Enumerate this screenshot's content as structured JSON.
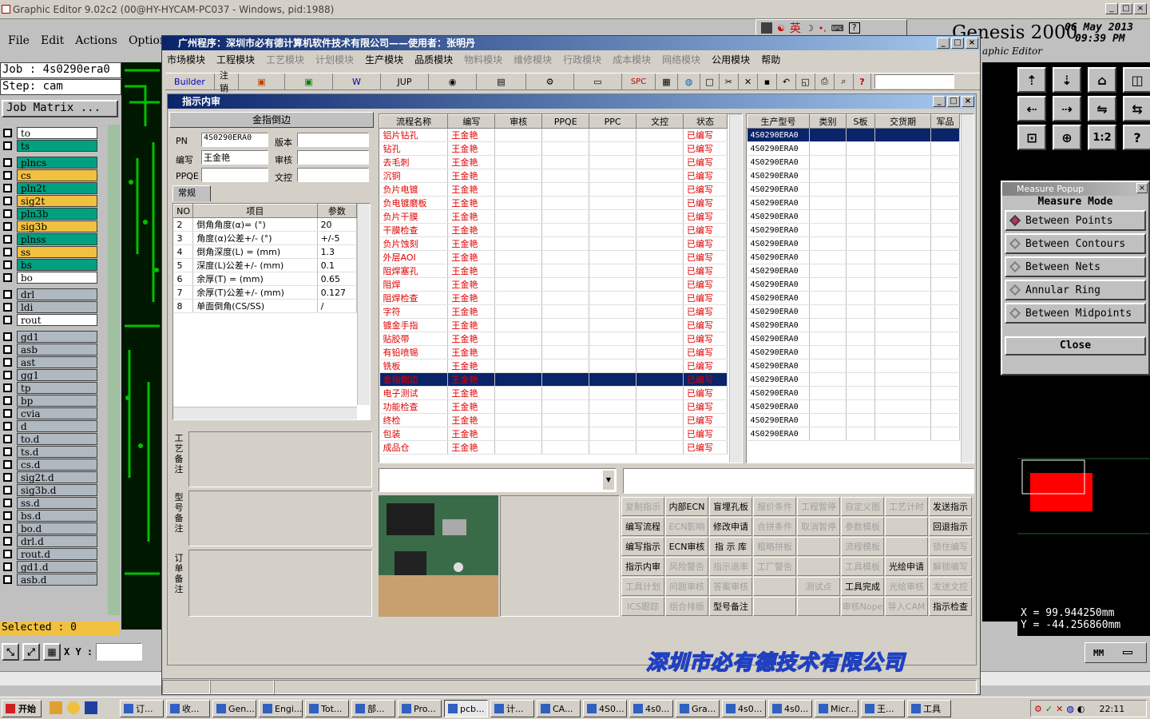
{
  "genesis": {
    "window_title": "Graphic Editor 9.02c2 (00@HY-HYCAM-PC037 - Windows, pid:1988)",
    "menu": [
      "File",
      "Edit",
      "Actions",
      "Option"
    ],
    "brand": "Genesis 2000",
    "subtitle": "aphic Editor",
    "date": "06 May 2013",
    "time": "09:39 PM",
    "job_label": "Job : 4s0290era0",
    "step_label": "Step: cam",
    "job_matrix": "Job Matrix ...",
    "selected": "Selected : 0",
    "xy_label": "X Y :",
    "coord_x": "X = 99.944250mm",
    "coord_y": "Y = -44.256860mm",
    "units": "MM",
    "ime_chars": "英",
    "layers": [
      {
        "name": "to",
        "color": "#ffffff"
      },
      {
        "name": "ts",
        "color": "#00a080"
      },
      {
        "name": "plncs",
        "color": "#00a080"
      },
      {
        "name": "cs",
        "color": "#f0c040"
      },
      {
        "name": "pln2t",
        "color": "#00a080"
      },
      {
        "name": "sig2t",
        "color": "#f0c040"
      },
      {
        "name": "pln3b",
        "color": "#00a080"
      },
      {
        "name": "sig3b",
        "color": "#f0c040"
      },
      {
        "name": "plnss",
        "color": "#00a080"
      },
      {
        "name": "ss",
        "color": "#f0c040"
      },
      {
        "name": "bs",
        "color": "#00a080"
      },
      {
        "name": "bo",
        "color": "#ffffff"
      },
      {
        "name": "drl",
        "color": "#b0b8c0"
      },
      {
        "name": "ldi",
        "color": "#b0b8c0"
      },
      {
        "name": "rout",
        "color": "#ffffff"
      },
      {
        "name": "gd1",
        "color": "#b0b8c0"
      },
      {
        "name": "asb",
        "color": "#b0b8c0"
      },
      {
        "name": "ast",
        "color": "#b0b8c0"
      },
      {
        "name": "gg1",
        "color": "#b0b8c0"
      },
      {
        "name": "tp",
        "color": "#b0b8c0"
      },
      {
        "name": "bp",
        "color": "#b0b8c0"
      },
      {
        "name": "cvia",
        "color": "#b0b8c0"
      },
      {
        "name": "d",
        "color": "#b0b8c0"
      },
      {
        "name": "to.d",
        "color": "#b0b8c0"
      },
      {
        "name": "ts.d",
        "color": "#b0b8c0"
      },
      {
        "name": "cs.d",
        "color": "#b0b8c0"
      },
      {
        "name": "sig2t.d",
        "color": "#b0b8c0"
      },
      {
        "name": "sig3b.d",
        "color": "#b0b8c0"
      },
      {
        "name": "ss.d",
        "color": "#b0b8c0"
      },
      {
        "name": "bs.d",
        "color": "#b0b8c0"
      },
      {
        "name": "bo.d",
        "color": "#b0b8c0"
      },
      {
        "name": "drl.d",
        "color": "#b0b8c0"
      },
      {
        "name": "rout.d",
        "color": "#b0b8c0"
      },
      {
        "name": "gd1.d",
        "color": "#b0b8c0"
      },
      {
        "name": "asb.d",
        "color": "#b0b8c0"
      }
    ]
  },
  "erp": {
    "title": "广州程序：深圳市必有德计算机软件技术有限公司——使用者：张明丹",
    "menu": [
      "市场模块",
      "工程模块",
      "工艺模块",
      "计划模块",
      "生产模块",
      "品质模块",
      "物料模块",
      "维修模块",
      "行政模块",
      "成本模块",
      "网络模块",
      "公用模块",
      "帮助"
    ],
    "toolbar": [
      "Builder",
      "注销",
      "JUP",
      "SPC"
    ],
    "mdi_title": "指示内审",
    "panel_title": "金指倒边",
    "fields": {
      "pn_label": "PN",
      "pn": "4S0290ERA0",
      "version_label": "版本",
      "author_label": "编写",
      "author": "王金艳",
      "review_label": "审核",
      "ppqe_label": "PPQE",
      "doc_label": "文控"
    },
    "tab": "常规",
    "param_headers": [
      "NO",
      "项目",
      "参数"
    ],
    "params": [
      {
        "no": "2",
        "item": "倒角角度(α)=  (°)",
        "val": "20"
      },
      {
        "no": "3",
        "item": "角度(α)公差+/-  (°)",
        "val": "+/-5"
      },
      {
        "no": "4",
        "item": "倒角深度(L) =   (mm)",
        "val": "1.3"
      },
      {
        "no": "5",
        "item": "深度(L)公差+/-   (mm)",
        "val": "0.1"
      },
      {
        "no": "6",
        "item": "余厚(T) =   (mm)",
        "val": "0.65"
      },
      {
        "no": "7",
        "item": "余厚(T)公差+/-   (mm)",
        "val": "0.127"
      },
      {
        "no": "8",
        "item": "单面倒角(CS/SS)",
        "val": "/"
      }
    ],
    "side_labels": [
      "工艺备注",
      "型号备注",
      "订单备注"
    ],
    "flow_headers": [
      "流程名称",
      "编写",
      "审核",
      "PPQE",
      "PPC",
      "文控",
      "状态"
    ],
    "flows": [
      "铝片钻孔",
      "钻孔",
      "去毛刺",
      "沉铜",
      "负片电镀",
      "负电镀磨板",
      "负片干膜",
      "干膜检查",
      "负片蚀刻",
      "外层AOI",
      "阻焊塞孔",
      "阻焊",
      "阻焊检查",
      "字符",
      "镀金手指",
      "贴胶带",
      "有铅喷锡",
      "铣板",
      "金指倒边",
      "电子测试",
      "功能检查",
      "终检",
      "包装",
      "成品仓"
    ],
    "flow_writer": "王金艳",
    "flow_status": "已编写",
    "selected_flow": "金指倒边",
    "part_headers": [
      "生产型号",
      "类别",
      "S板",
      "交货期",
      "军品"
    ],
    "part_no": "4S0290ERA0",
    "buttons": [
      [
        "复制指示",
        "内部ECN",
        "盲埋孔板",
        "报价条件",
        "工程暂停",
        "自定义图",
        "工艺计时",
        "发送指示"
      ],
      [
        "编写流程",
        "ECN影响",
        "修改申请",
        "合拼条件",
        "取消暂停",
        "参数模板",
        "",
        "回退指示"
      ],
      [
        "编写指示",
        "ECN审核",
        "指 示 库",
        "粗略拼板",
        "",
        "流程模板",
        "",
        "锁住编写"
      ],
      [
        "指示内审",
        "风险警告",
        "指示退率",
        "工厂警告",
        "",
        "工具模板",
        "光绘申请",
        "解锁编写"
      ],
      [
        "工具计划",
        "问题审核",
        "答案审核",
        "",
        "测试点",
        "工具完成",
        "光绘审核",
        "发送文控"
      ],
      [
        "ICS跟踪",
        "组合排版",
        "型号备注",
        "",
        "",
        "审核Nope",
        "导入CAM",
        "指示检查"
      ]
    ],
    "enabled": [
      "内部ECN",
      "盲埋孔板",
      "发送指示",
      "编写流程",
      "修改申请",
      "回退指示",
      "编写指示",
      "ECN审核",
      "指 示 库",
      "指示内审",
      "光绘申请",
      "工具完成",
      "型号备注",
      "指示检查"
    ],
    "banner": "深圳市必有德技术有限公司"
  },
  "measure": {
    "title": "Measure Popup",
    "mode": "Measure Mode",
    "options": [
      "Between Points",
      "Between Contours",
      "Between Nets",
      "Annular Ring",
      "Between Midpoints"
    ],
    "close": "Close"
  },
  "taskbar": {
    "start": "开始",
    "tasks": [
      "订...",
      "收...",
      "Gen...",
      "Engi...",
      "Tot...",
      "部...",
      "Pro...",
      "pcb...",
      "计...",
      "CA...",
      "4S0...",
      "4s0...",
      "Gra...",
      "4s0...",
      "4s0...",
      "Micr...",
      "王...",
      "工具"
    ],
    "clock": "22:11"
  }
}
